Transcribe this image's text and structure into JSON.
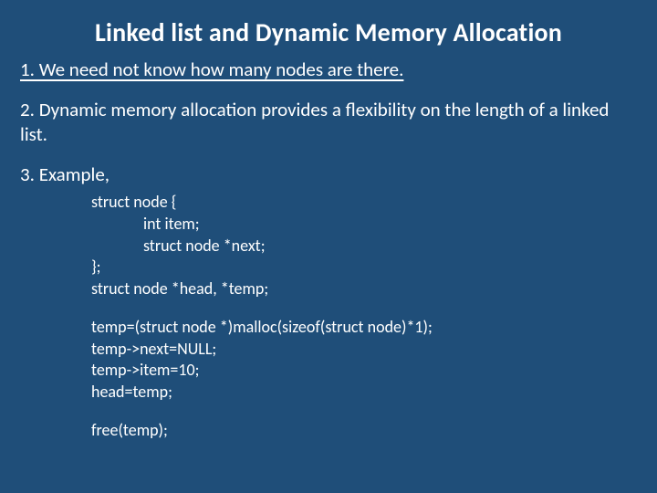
{
  "title": "Linked list and Dynamic Memory Allocation",
  "points": {
    "p1": "1.   We need not know how many nodes are there.",
    "p2": "2. Dynamic memory allocation provides a flexibility on the length of a linked list.",
    "p3": "3. Example,"
  },
  "code": {
    "g1": {
      "l1": "struct node {",
      "l2": "              int item;",
      "l3": "              struct node *next;",
      "l4": "};",
      "l5": "struct node *head, *temp;"
    },
    "g2": {
      "l1": "temp=(struct node *)malloc(sizeof(struct node)*1);",
      "l2": "temp->next=NULL;",
      "l3": "temp->item=10;",
      "l4": "head=temp;"
    },
    "g3": {
      "l1": "free(temp);"
    }
  }
}
